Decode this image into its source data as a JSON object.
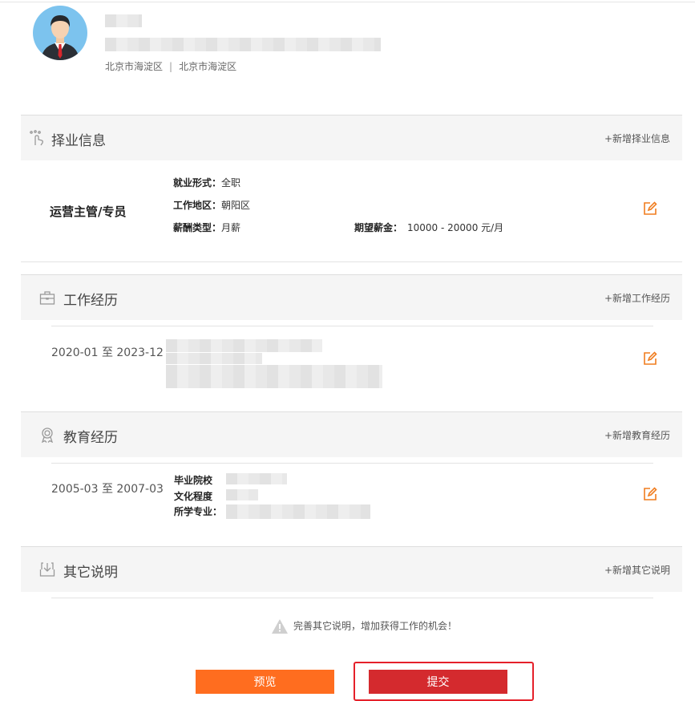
{
  "profile": {
    "location_current": "北京市海淀区",
    "location_separator": "|",
    "location_home": "北京市海淀区"
  },
  "job_intention": {
    "section_title": "择业信息",
    "add_label": "+新增择业信息",
    "position": "运营主管/专员",
    "employment_type_label": "就业形式：",
    "employment_type_value": "全职",
    "work_area_label": "工作地区：",
    "work_area_value": "朝阳区",
    "salary_type_label": "薪酬类型：",
    "salary_type_value": "月薪",
    "expected_salary_label": "期望薪金：",
    "expected_salary_value": "10000 - 20000 元/月"
  },
  "work_experience": {
    "section_title": "工作经历",
    "add_label": "+新增工作经历",
    "date_range": "2020-01 至 2023-12"
  },
  "education": {
    "section_title": "教育经历",
    "add_label": "+新增教育经历",
    "date_range": "2005-03 至 2007-03",
    "school_label": "毕业院校",
    "degree_label": "文化程度",
    "major_label": "所学专业："
  },
  "other": {
    "section_title": "其它说明",
    "add_label": "+新增其它说明",
    "tip": "完善其它说明，增加获得工作的机会！"
  },
  "actions": {
    "preview_label": "预览",
    "submit_label": "提交"
  },
  "colors": {
    "accent_orange": "#ff6d1f",
    "submit_red": "#d42a2e",
    "highlight_border": "#e5202a",
    "edit_icon": "#f07d1f"
  }
}
